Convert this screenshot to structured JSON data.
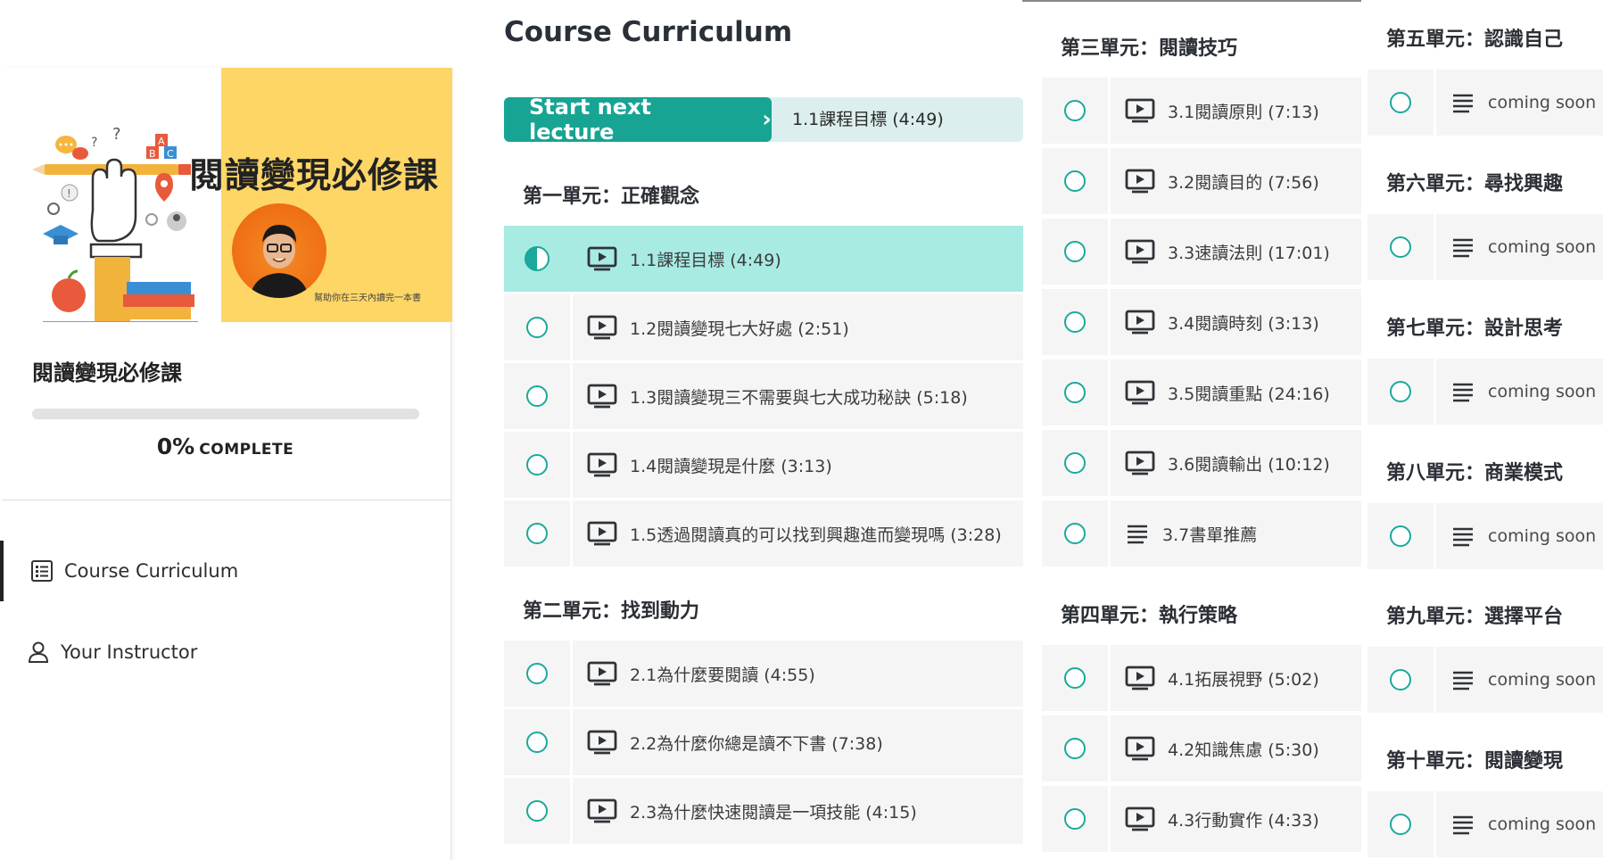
{
  "cover": {
    "title": "閱讀變現必修課",
    "subtitle": "幫助你在三天內讀完一本書"
  },
  "sidebar": {
    "course_title": "閱讀變現必修課",
    "progress": {
      "percent_text": "0%",
      "complete_label": "COMPLETE",
      "value": 0
    },
    "nav": [
      {
        "label": "Course Curriculum",
        "icon": "curriculum-list-icon",
        "active": true
      },
      {
        "label": "Your Instructor",
        "icon": "user-icon",
        "active": false
      }
    ]
  },
  "main": {
    "title": "Course Curriculum",
    "next": {
      "button_label": "Start next lecture",
      "lecture": "1.1課程目標 (4:49)"
    }
  },
  "colors": {
    "accent": "#17a493",
    "current_row": "#a8ebe3",
    "row_bg": "#f5f5f5",
    "cover_yellow": "#fdd666"
  },
  "sections": [
    {
      "title": "第一單元：正確觀念",
      "lectures": [
        {
          "title": "1.1課程目標 (4:49)",
          "type": "video",
          "status": "in-progress",
          "current": true
        },
        {
          "title": "1.2閱讀變現七大好處 (2:51)",
          "type": "video",
          "status": "not-started"
        },
        {
          "title": "1.3閱讀變現三不需要與七大成功秘訣 (5:18)",
          "type": "video",
          "status": "not-started"
        },
        {
          "title": "1.4閱讀變現是什麼 (3:13)",
          "type": "video",
          "status": "not-started"
        },
        {
          "title": "1.5透過閱讀真的可以找到興趣進而變現嗎 (3:28)",
          "type": "video",
          "status": "not-started"
        }
      ]
    },
    {
      "title": "第二單元：找到動力",
      "lectures": [
        {
          "title": "2.1為什麼要閱讀 (4:55)",
          "type": "video",
          "status": "not-started"
        },
        {
          "title": "2.2為什麼你總是讀不下書 (7:38)",
          "type": "video",
          "status": "not-started"
        },
        {
          "title": "2.3為什麼快速閱讀是一項技能 (4:15)",
          "type": "video",
          "status": "not-started"
        }
      ]
    },
    {
      "title": "第三單元：閱讀技巧",
      "lectures": [
        {
          "title": "3.1閱讀原則 (7:13)",
          "type": "video",
          "status": "not-started"
        },
        {
          "title": "3.2閱讀目的 (7:56)",
          "type": "video",
          "status": "not-started"
        },
        {
          "title": "3.3速讀法則 (17:01)",
          "type": "video",
          "status": "not-started"
        },
        {
          "title": "3.4閱讀時刻 (3:13)",
          "type": "video",
          "status": "not-started"
        },
        {
          "title": "3.5閱讀重點 (24:16)",
          "type": "video",
          "status": "not-started"
        },
        {
          "title": "3.6閱讀輸出 (10:12)",
          "type": "video",
          "status": "not-started"
        },
        {
          "title": "3.7書單推薦",
          "type": "text",
          "status": "not-started"
        }
      ]
    },
    {
      "title": "第四單元：執行策略",
      "lectures": [
        {
          "title": "4.1拓展視野 (5:02)",
          "type": "video",
          "status": "not-started"
        },
        {
          "title": "4.2知識焦慮 (5:30)",
          "type": "video",
          "status": "not-started"
        },
        {
          "title": "4.3行動實作 (4:33)",
          "type": "video",
          "status": "not-started"
        }
      ]
    },
    {
      "title": "第五單元：認識自己",
      "lectures": [
        {
          "title": "coming soon",
          "type": "text",
          "status": "not-started"
        }
      ]
    },
    {
      "title": "第六單元：尋找興趣",
      "lectures": [
        {
          "title": "coming soon",
          "type": "text",
          "status": "not-started"
        }
      ]
    },
    {
      "title": "第七單元：設計思考",
      "lectures": [
        {
          "title": "coming soon",
          "type": "text",
          "status": "not-started"
        }
      ]
    },
    {
      "title": "第八單元：商業模式",
      "lectures": [
        {
          "title": "coming soon",
          "type": "text",
          "status": "not-started"
        }
      ]
    },
    {
      "title": "第九單元：選擇平台",
      "lectures": [
        {
          "title": "coming soon",
          "type": "text",
          "status": "not-started"
        }
      ]
    },
    {
      "title": "第十單元：閱讀變現",
      "lectures": [
        {
          "title": "coming soon",
          "type": "text",
          "status": "not-started"
        }
      ]
    }
  ]
}
